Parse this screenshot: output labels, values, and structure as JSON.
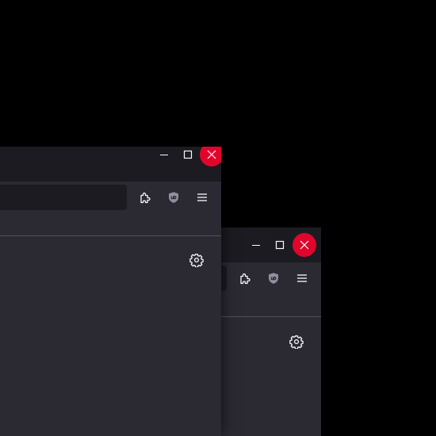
{
  "desktop": {
    "background": "#000000"
  },
  "theme": {
    "titlebar": "#1c1b22",
    "toolbar": "#2b2a33",
    "urlbar": "#1c1b22",
    "separator": "#52525e",
    "icon": "#fbfbfe",
    "close_hover": "#e0062b",
    "shield": "#8f8f9d"
  },
  "windows": [
    {
      "id": "back-window",
      "controls": [
        "minimize-icon",
        "maximize-icon",
        "close-icon"
      ],
      "toolbar_icons": [
        "extensions-icon",
        "ublock-origin-icon",
        "menu-icon"
      ],
      "content_icons": [
        "gear-icon"
      ]
    },
    {
      "id": "front-window",
      "controls": [
        "minimize-icon",
        "maximize-icon",
        "close-icon"
      ],
      "toolbar_icons": [
        "extensions-icon",
        "ublock-origin-icon",
        "menu-icon"
      ],
      "content_icons": [
        "gear-icon"
      ]
    }
  ]
}
